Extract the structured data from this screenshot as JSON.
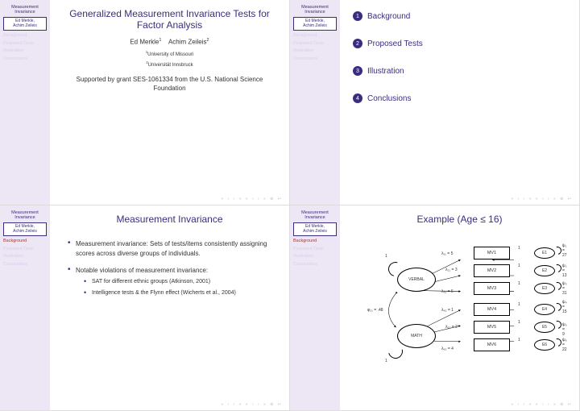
{
  "sidebar": {
    "short_title_l1": "Measurement",
    "short_title_l2": "Invariance",
    "authors_l1": "Ed Merkle,",
    "authors_l2": "Achim Zeileis",
    "items": [
      "Background",
      "Proposed Tests",
      "Illustration",
      "Conclusions"
    ]
  },
  "navdots": "« ‹ › »  « ‹ › »  ⊘  ↩",
  "slide1": {
    "title": "Generalized Measurement Invariance Tests for Factor Analysis",
    "author1": "Ed Merkle",
    "author1_sup": "1",
    "author2": "Achim Zeileis",
    "author2_sup": "2",
    "aff1_sup": "1",
    "aff1": "University of Missouri",
    "aff2_sup": "2",
    "aff2": "Universität Innsbruck",
    "support": "Supported by grant SES-1061334 from the U.S. National Science Foundation"
  },
  "slide2": {
    "outline": [
      {
        "n": "1",
        "label": "Background"
      },
      {
        "n": "2",
        "label": "Proposed Tests"
      },
      {
        "n": "3",
        "label": "Illustration"
      },
      {
        "n": "4",
        "label": "Conclusions"
      }
    ]
  },
  "slide3": {
    "title": "Measurement Invariance",
    "b1": "Measurement invariance: Sets of tests/items consistently assigning scores across diverse groups of individuals.",
    "b2": "Notable violations of measurement invariance:",
    "b2a": "SAT for different ethnic groups (Atkinson, 2001)",
    "b2b": "Intelligence tests & the Flynn effect (Wicherts et al., 2004)"
  },
  "slide4": {
    "title": "Example (Age ≤ 16)",
    "nodes": {
      "verbal": "VERBAL",
      "math": "MATH",
      "mv": [
        "MV1",
        "MV2",
        "MV3",
        "MV4",
        "MV5",
        "MV6"
      ],
      "e": [
        "E1",
        "E2",
        "E3",
        "E4",
        "E5",
        "E6"
      ]
    },
    "lambdas": [
      "λ₁₁ = 5",
      "λ₂₁ = 3",
      "λ₃₁ = 6",
      "λ₄₂ = 1",
      "λ₅₂ = 2",
      "λ₆₂ = 4"
    ],
    "psis": [
      "ψ₁ = 27",
      "ψ₂ = 13",
      "ψ₃ = 31",
      "ψ₄ = 15",
      "ψ₅ = 9",
      "ψ₆ = 22"
    ],
    "phi": "φ₂₁ = .48",
    "ones": "1"
  }
}
